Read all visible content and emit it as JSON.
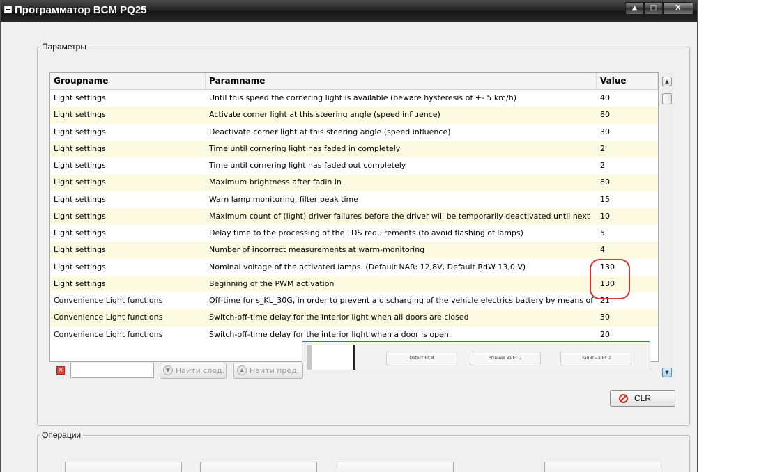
{
  "window": {
    "title": "Программатор BCM PQ25",
    "controls": {
      "minimize_icon": "minimize-icon",
      "maximize_icon": "maximize-icon",
      "close_label": "X"
    }
  },
  "params_group": {
    "legend": "Параметры",
    "columns": [
      "Groupname",
      "Paramname",
      "Value"
    ],
    "rows": [
      {
        "group": "Light settings",
        "param": "Until this speed the cornering light is available (beware hysteresis of +- 5 km/h)",
        "value": "40"
      },
      {
        "group": "Light settings",
        "param": "Activate corner light at this steering angle (speed influence)",
        "value": "80"
      },
      {
        "group": "Light settings",
        "param": "Deactivate corner light at this steering angle (speed influence)",
        "value": "30"
      },
      {
        "group": "Light settings",
        "param": "Time until cornering light has faded in completely",
        "value": "2"
      },
      {
        "group": "Light settings",
        "param": "Time until cornering light has faded out completely",
        "value": "2"
      },
      {
        "group": "Light settings",
        "param": "Maximum brightness after fadin in",
        "value": "80"
      },
      {
        "group": "Light settings",
        "param": "Warn lamp monitoring, filter peak time",
        "value": "15"
      },
      {
        "group": "Light settings",
        "param": "Maximum count of (light) driver failures before the driver will be temporarily deactivated until next",
        "value": "10"
      },
      {
        "group": "Light settings",
        "param": "Delay time to the processing of the LDS requirements (to avoid flashing of lamps)",
        "value": "5"
      },
      {
        "group": "Light settings",
        "param": "Number of incorrect measurements at warm-monitoring",
        "value": "4"
      },
      {
        "group": "Light settings",
        "param": "Nominal voltage of the activated lamps. (Default NAR: 12,8V, Default RdW 13,0 V)",
        "value": "130"
      },
      {
        "group": "Light settings",
        "param": "Beginning of the PWM activation",
        "value": "130"
      },
      {
        "group": "Convenience Light functions",
        "param": "Off-time for s_KL_30G, in order to prevent a discharging of the vehicle electrics battery by means of",
        "value": "21"
      },
      {
        "group": "Convenience Light functions",
        "param": "Switch-off-time delay for the interior light when all doors are closed",
        "value": "30"
      },
      {
        "group": "Convenience Light functions",
        "param": "Switch-off-time delay for the interior light when a door is open.",
        "value": "20"
      }
    ],
    "overlay": {
      "detect": "Detect BCM",
      "read": "Чтение из ECU",
      "write": "Запись в ECU"
    },
    "search": {
      "value": "",
      "next_label": "Найти след.",
      "prev_label": "Найти пред."
    },
    "clr_label": "CLR"
  },
  "ops_group": {
    "legend": "Операции"
  },
  "colors": {
    "highlight": "#e03030",
    "alt_row": "#fcfae0"
  }
}
